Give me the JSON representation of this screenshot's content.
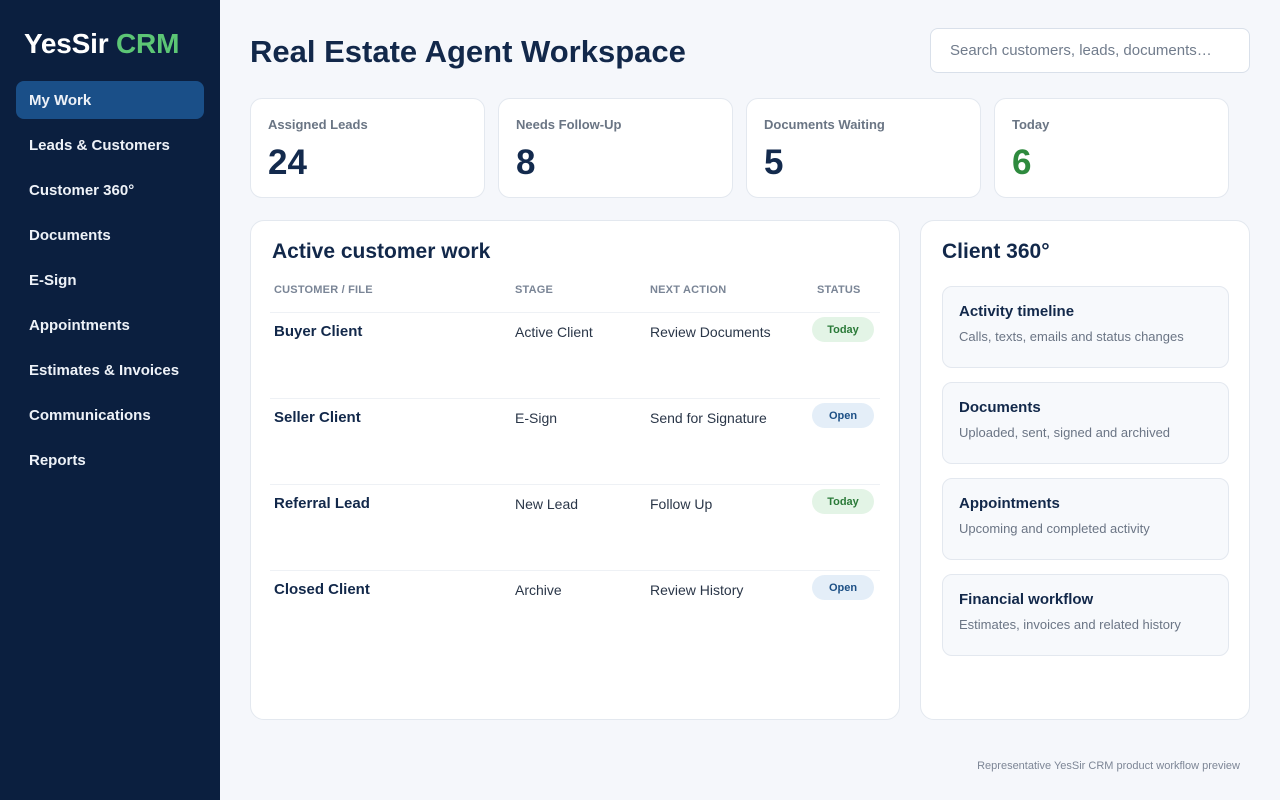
{
  "brand": {
    "name": "YesSir",
    "accent": "CRM"
  },
  "nav": [
    {
      "label": "My Work"
    },
    {
      "label": "Leads & Customers"
    },
    {
      "label": "Customer 360°"
    },
    {
      "label": "Documents"
    },
    {
      "label": "E-Sign"
    },
    {
      "label": "Appointments"
    },
    {
      "label": "Estimates & Invoices"
    },
    {
      "label": "Communications"
    },
    {
      "label": "Reports"
    }
  ],
  "page_title": "Real Estate Agent Workspace",
  "search": {
    "placeholder": "Search customers, leads, documents…"
  },
  "stats": [
    {
      "label": "Assigned Leads",
      "value": "24"
    },
    {
      "label": "Needs Follow-Up",
      "value": "8"
    },
    {
      "label": "Documents Waiting",
      "value": "5"
    },
    {
      "label": "Today",
      "value": "6"
    }
  ],
  "work": {
    "title": "Active customer work",
    "columns": [
      "CUSTOMER / FILE",
      "STAGE",
      "NEXT ACTION",
      "STATUS"
    ],
    "rows": [
      {
        "customer": "Buyer Client",
        "stage": "Active Client",
        "next": "Review Documents",
        "status": "Today"
      },
      {
        "customer": "Seller Client",
        "stage": "E-Sign",
        "next": "Send for Signature",
        "status": "Open"
      },
      {
        "customer": "Referral Lead",
        "stage": "New Lead",
        "next": "Follow Up",
        "status": "Today"
      },
      {
        "customer": "Closed Client",
        "stage": "Archive",
        "next": "Review History",
        "status": "Open"
      }
    ]
  },
  "client360": {
    "title": "Client 360°",
    "modules": [
      {
        "title": "Activity timeline",
        "desc": "Calls, texts, emails and status changes"
      },
      {
        "title": "Documents",
        "desc": "Uploaded, sent, signed and archived"
      },
      {
        "title": "Appointments",
        "desc": "Upcoming and completed activity"
      },
      {
        "title": "Financial workflow",
        "desc": "Estimates, invoices and related history"
      }
    ]
  },
  "footer": "Representative YesSir CRM product workflow preview",
  "colors": {
    "sidebar": "#0b1f3f",
    "active_nav": "#1a4f88",
    "brand_accent": "#5cc675",
    "today_badge": "#e3f4e6",
    "open_badge": "#e4eef8"
  }
}
